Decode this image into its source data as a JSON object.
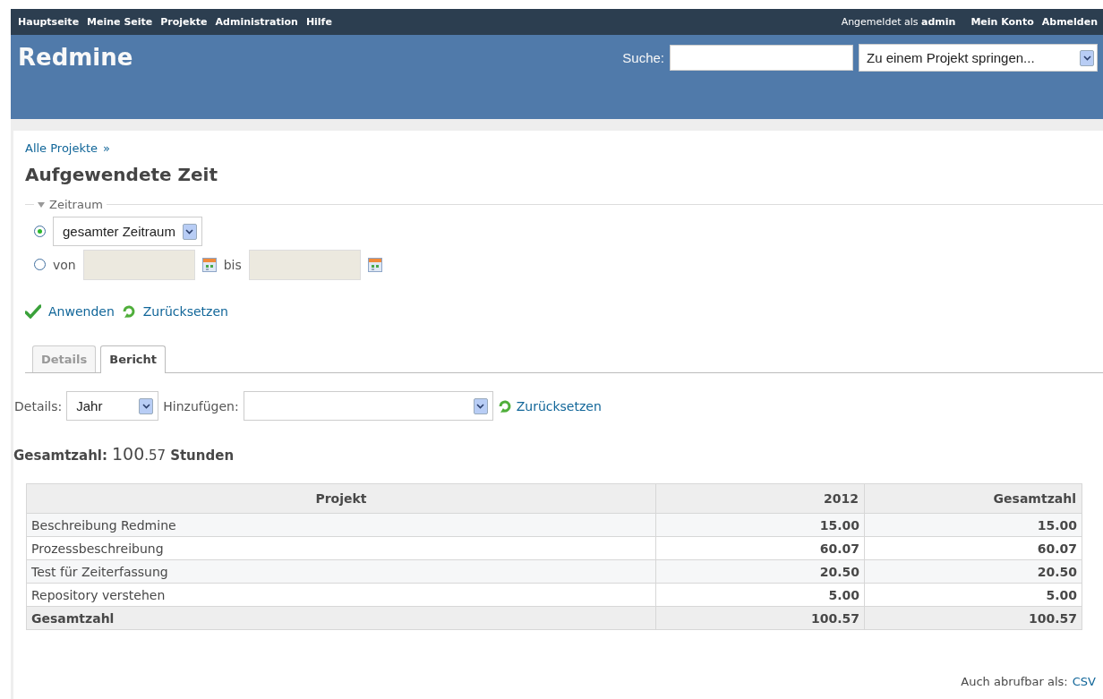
{
  "top_menu": {
    "items": [
      "Hauptseite",
      "Meine Seite",
      "Projekte",
      "Administration",
      "Hilfe"
    ],
    "logged_in_prefix": "Angemeldet als",
    "logged_in_user": "admin",
    "account_links": [
      "Mein Konto",
      "Abmelden"
    ]
  },
  "header": {
    "title": "Redmine",
    "search_label": "Suche:",
    "project_jump": "Zu einem Projekt springen..."
  },
  "breadcrumb": {
    "link": "Alle Projekte",
    "separator": "»"
  },
  "title": "Aufgewendete Zeit",
  "filter": {
    "legend": "Zeitraum",
    "expanded": true,
    "options": [
      {
        "kind": "period",
        "selected": true,
        "value": "gesamter Zeitraum"
      },
      {
        "kind": "range",
        "selected": false,
        "from_label": "von",
        "to_label": "bis"
      }
    ]
  },
  "actions": [
    {
      "kind": "apply",
      "label": "Anwenden"
    },
    {
      "kind": "reset",
      "label": "Zurücksetzen"
    }
  ],
  "tabs": [
    {
      "label": "Details",
      "selected": false
    },
    {
      "label": "Bericht",
      "selected": true
    }
  ],
  "report": {
    "details_label": "Details:",
    "details_value": "Jahr",
    "add_label": "Hinzufügen:",
    "reset": "Zurücksetzen"
  },
  "total": {
    "label": "Gesamtzahl:",
    "hours": "100.57",
    "unit": "Stunden"
  },
  "table": {
    "columns": [
      "Projekt",
      "2012",
      "Gesamtzahl"
    ],
    "rows": [
      [
        "Beschreibung Redmine",
        "15.00",
        "15.00"
      ],
      [
        "Prozessbeschreibung",
        "60.07",
        "60.07"
      ],
      [
        "Test für Zeiterfassung",
        "20.50",
        "20.50"
      ],
      [
        "Repository verstehen",
        "5.00",
        "5.00"
      ]
    ],
    "total_row": [
      "Gesamtzahl",
      "100.57",
      "100.57"
    ]
  },
  "footer": {
    "label": "Auch abrufbar als:",
    "link": "CSV"
  }
}
